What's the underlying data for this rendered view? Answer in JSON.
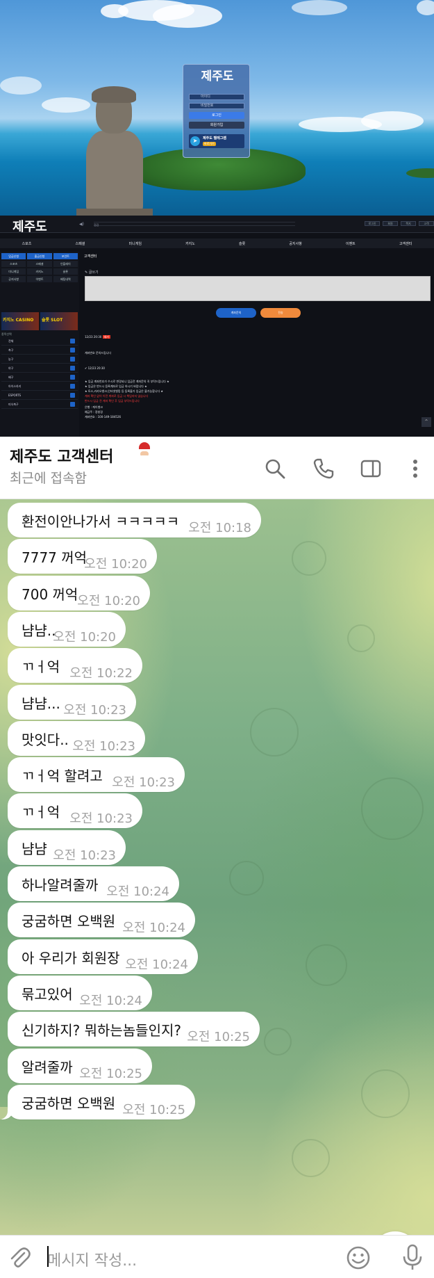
{
  "site": {
    "logo": "제주도",
    "login_placeholders": [
      "아이디",
      "비밀번호"
    ],
    "login_button": "로그인",
    "join_button": "회원가입",
    "telegram_title": "제주도 텔레그램",
    "telegram_sub": "바로가기",
    "ticker": "점검",
    "top_buttons": [
      "로그인",
      "회원",
      "쪽지",
      "고객"
    ],
    "nav": [
      "스포츠",
      "스페셜",
      "미니게임",
      "카지노",
      "슬롯",
      "공지사항",
      "이벤트",
      "고객센터"
    ],
    "left_grid": [
      {
        "label": "입금신청",
        "active": true
      },
      {
        "label": "출금신청",
        "active": true
      },
      {
        "label": "포인트",
        "active": true
      },
      {
        "label": "스포츠",
        "active": false
      },
      {
        "label": "스페셜",
        "active": false
      },
      {
        "label": "인플레이",
        "active": false
      },
      {
        "label": "미니게임",
        "active": false
      },
      {
        "label": "카지노",
        "active": false
      },
      {
        "label": "슬롯",
        "active": false
      },
      {
        "label": "공지사항",
        "active": false
      },
      {
        "label": "이벤트",
        "active": false
      },
      {
        "label": "배팅내역",
        "active": false
      }
    ],
    "casino_banner": "카지노 CASINO",
    "slot_banner": "슬롯 SLOT",
    "leagues_title": "종목선택",
    "leagues": [
      "전체",
      "축구",
      "농구",
      "야구",
      "배구",
      "아이스하키",
      "ESPORTS",
      "미식축구"
    ],
    "page_title": "고객센터",
    "write_label": "글쓰기",
    "account_btn": "계좌문의",
    "submit_btn": "전송",
    "post1_date": "12/23 20:30",
    "post1_badge": "대기",
    "post1_text": "계좌번호 문의드립니다",
    "post2_date": "12/23 20:30",
    "notice_lines": [
      "★ 입금 계좌번호가 수시로 변경되니 입금전 계좌문의 꼭 부탁드립니다 ★",
      "★ 입금은 반드시 등록계좌로 입금 하시기 바랍니다 ★",
      "★ 토스,카카오뱅크,인터넷뱅킹 등 등록불가 입금은 불가능합니다 ★"
    ],
    "warn_lines": [
      "계좌 확인 없이 이전 계좌로 입금 시 책임지지 않습니다",
      "반드시 입금 전 계좌 확인 후 입금 부탁드립니다"
    ],
    "bank_lines": [
      "은행 : 케이뱅크",
      "예금주 : 정창경",
      "계좌번호 : 100-149-184526"
    ]
  },
  "chat": {
    "title": "제주도 고객센터",
    "status": "최근에 접속함",
    "messages": [
      {
        "text": "환전이안나가서 ㅋㅋㅋㅋㅋ",
        "time": "오전 10:18"
      },
      {
        "text": "7777 꺼억",
        "time": "오전 10:20"
      },
      {
        "text": "700 꺼억",
        "time": "오전 10:20"
      },
      {
        "text": "냠냠..",
        "time": "오전 10:20"
      },
      {
        "text": "ㄲㅓ억",
        "time": "오전 10:22"
      },
      {
        "text": "냠냠...",
        "time": "오전 10:23"
      },
      {
        "text": "맛잇다..",
        "time": "오전 10:23"
      },
      {
        "text": "ㄲㅓ억 할려고",
        "time": "오전 10:23"
      },
      {
        "text": "ㄲㅓ억",
        "time": "오전 10:23"
      },
      {
        "text": "냠냠",
        "time": "오전 10:23"
      },
      {
        "text": "하나알려줄까",
        "time": "오전 10:24"
      },
      {
        "text": "궁굼하면 오백원",
        "time": "오전 10:24"
      },
      {
        "text": "아 우리가 회원장",
        "time": "오전 10:24"
      },
      {
        "text": "묶고있어",
        "time": "오전 10:24"
      },
      {
        "text": "신기하지? 뭐하는놈들인지?",
        "time": "오전 10:25"
      },
      {
        "text": "알려줄까",
        "time": "오전 10:25"
      },
      {
        "text": "궁굼하면 오백원",
        "time": "오전 10:25"
      }
    ],
    "compose_placeholder": "메시지 작성..."
  }
}
